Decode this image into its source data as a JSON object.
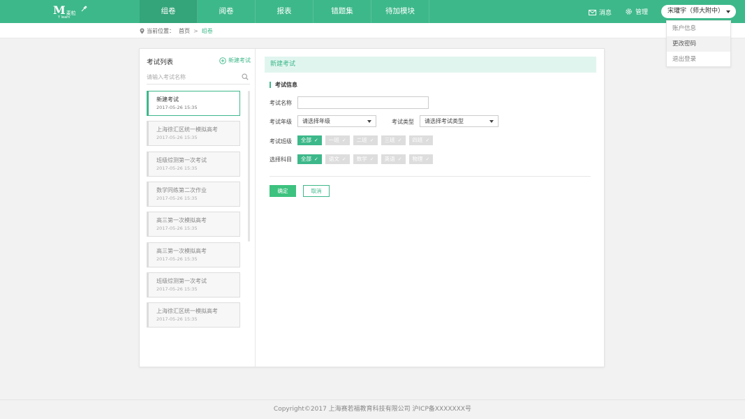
{
  "logo": {
    "main": "M",
    "sub": "麦粒",
    "sub2": "Y learn"
  },
  "nav": [
    {
      "label": "组卷",
      "active": true
    },
    {
      "label": "阅卷"
    },
    {
      "label": "报表"
    },
    {
      "label": "错题集"
    },
    {
      "label": "待加模块"
    }
  ],
  "topright": {
    "message_label": "消息",
    "manage_label": "管理",
    "user_label": "宋瓘宇（师大附中）"
  },
  "user_menu": [
    {
      "label": "账户信息"
    },
    {
      "label": "更改密码",
      "active": true
    },
    {
      "label": "退出登录"
    }
  ],
  "breadcrumb": {
    "prefix": "当前位置：",
    "home": "首页",
    "separator": ">",
    "current": "组卷"
  },
  "exam_list": {
    "title": "考试列表",
    "new_label": "新建考试",
    "search_placeholder": "请输入考试名称",
    "items": [
      {
        "name": "新建考试",
        "date": "2017-05-26 15:35",
        "active": true
      },
      {
        "name": "上海徐汇区统一模拟高考",
        "date": "2017-05-26 15:35"
      },
      {
        "name": "班级综测第一次考试",
        "date": "2017-05-26 15:35"
      },
      {
        "name": "数学同练第二次作业",
        "date": "2017-05-26 15:35"
      },
      {
        "name": "高三第一次模拟高考",
        "date": "2017-05-26 15:35"
      },
      {
        "name": "高三第一次模拟高考",
        "date": "2017-05-26 15:35"
      },
      {
        "name": "班级综测第一次考试",
        "date": "2017-05-26 15:35"
      },
      {
        "name": "上海徐汇区统一模拟高考",
        "date": "2017-05-26 15:35"
      }
    ]
  },
  "form": {
    "header": "新建考试",
    "section": "考试信息",
    "name_label": "考试名称",
    "name_value": "",
    "grade_label": "考试年级",
    "grade_value": "请选择年级",
    "type_label": "考试类型",
    "type_value": "请选择考试类型",
    "class_label": "考试班级",
    "classes": [
      {
        "label": "全部",
        "on": true
      },
      {
        "label": "一班"
      },
      {
        "label": "二班"
      },
      {
        "label": "三班"
      },
      {
        "label": "四班"
      }
    ],
    "subject_label": "选择科目",
    "subjects": [
      {
        "label": "全部",
        "on": true
      },
      {
        "label": "语文"
      },
      {
        "label": "数学"
      },
      {
        "label": "英语"
      },
      {
        "label": "物理"
      }
    ],
    "ok_label": "确定",
    "cancel_label": "取消"
  },
  "footer": {
    "text": "Copyright©2017  上海赛若福教育科技有限公司  沪ICP备XXXXXXX号"
  },
  "colors": {
    "primary": "#3db88a",
    "primary_dark": "#34a47a",
    "confirm": "#3ec27f",
    "header_tint": "#e1f5ef"
  }
}
